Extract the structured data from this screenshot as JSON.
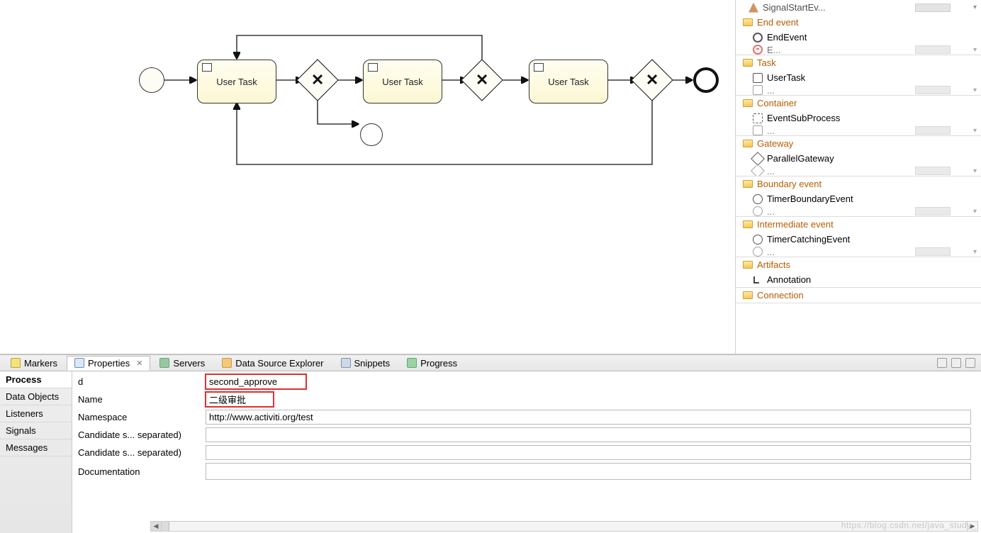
{
  "canvas": {
    "tasks": [
      {
        "label": "User Task"
      },
      {
        "label": "User Task"
      },
      {
        "label": "User Task"
      }
    ]
  },
  "palette": {
    "top_extra": {
      "label": "SignalStartEv..."
    },
    "drawers": [
      {
        "title": "End event",
        "items": [
          {
            "label": "EndEvent",
            "icon": "stop"
          },
          {
            "label": "E...",
            "icon": "end",
            "partial": true
          }
        ]
      },
      {
        "title": "Task",
        "items": [
          {
            "label": "UserTask",
            "icon": "square"
          },
          {
            "label": "...",
            "icon": "square",
            "partial": true
          }
        ]
      },
      {
        "title": "Container",
        "items": [
          {
            "label": "EventSubProcess",
            "icon": "dashed"
          },
          {
            "label": "...",
            "icon": "square",
            "partial": true
          }
        ]
      },
      {
        "title": "Gateway",
        "items": [
          {
            "label": "ParallelGateway",
            "icon": "diamond"
          },
          {
            "label": "...",
            "icon": "diamond",
            "partial": true
          }
        ]
      },
      {
        "title": "Boundary event",
        "items": [
          {
            "label": "TimerBoundaryEvent",
            "icon": "round"
          },
          {
            "label": "...",
            "icon": "round",
            "partial": true
          }
        ]
      },
      {
        "title": "Intermediate event",
        "items": [
          {
            "label": "TimerCatchingEvent",
            "icon": "round"
          },
          {
            "label": "...",
            "icon": "round",
            "partial": true
          }
        ]
      },
      {
        "title": "Artifacts",
        "items": [
          {
            "label": "Annotation",
            "icon": "l"
          }
        ]
      },
      {
        "title": "Connection",
        "items": []
      }
    ]
  },
  "tabs": {
    "markers": "Markers",
    "properties": "Properties",
    "servers": "Servers",
    "dsx": "Data Source Explorer",
    "snippets": "Snippets",
    "progress": "Progress"
  },
  "propsNav": {
    "process": "Process",
    "dataObjects": "Data Objects",
    "listeners": "Listeners",
    "signals": "Signals",
    "messages": "Messages"
  },
  "props": {
    "id_label": "d",
    "id_value": "second_approve",
    "name_label": "Name",
    "name_value": "二级审批",
    "ns_label": "Namespace",
    "ns_value": "http://www.activiti.org/test",
    "cand1_label": "Candidate s... separated)",
    "cand1_value": "",
    "cand2_label": "Candidate s... separated)",
    "cand2_value": "",
    "doc_label": "Documentation",
    "doc_value": ""
  },
  "watermark": "https://blog.csdn.net/java_study_"
}
